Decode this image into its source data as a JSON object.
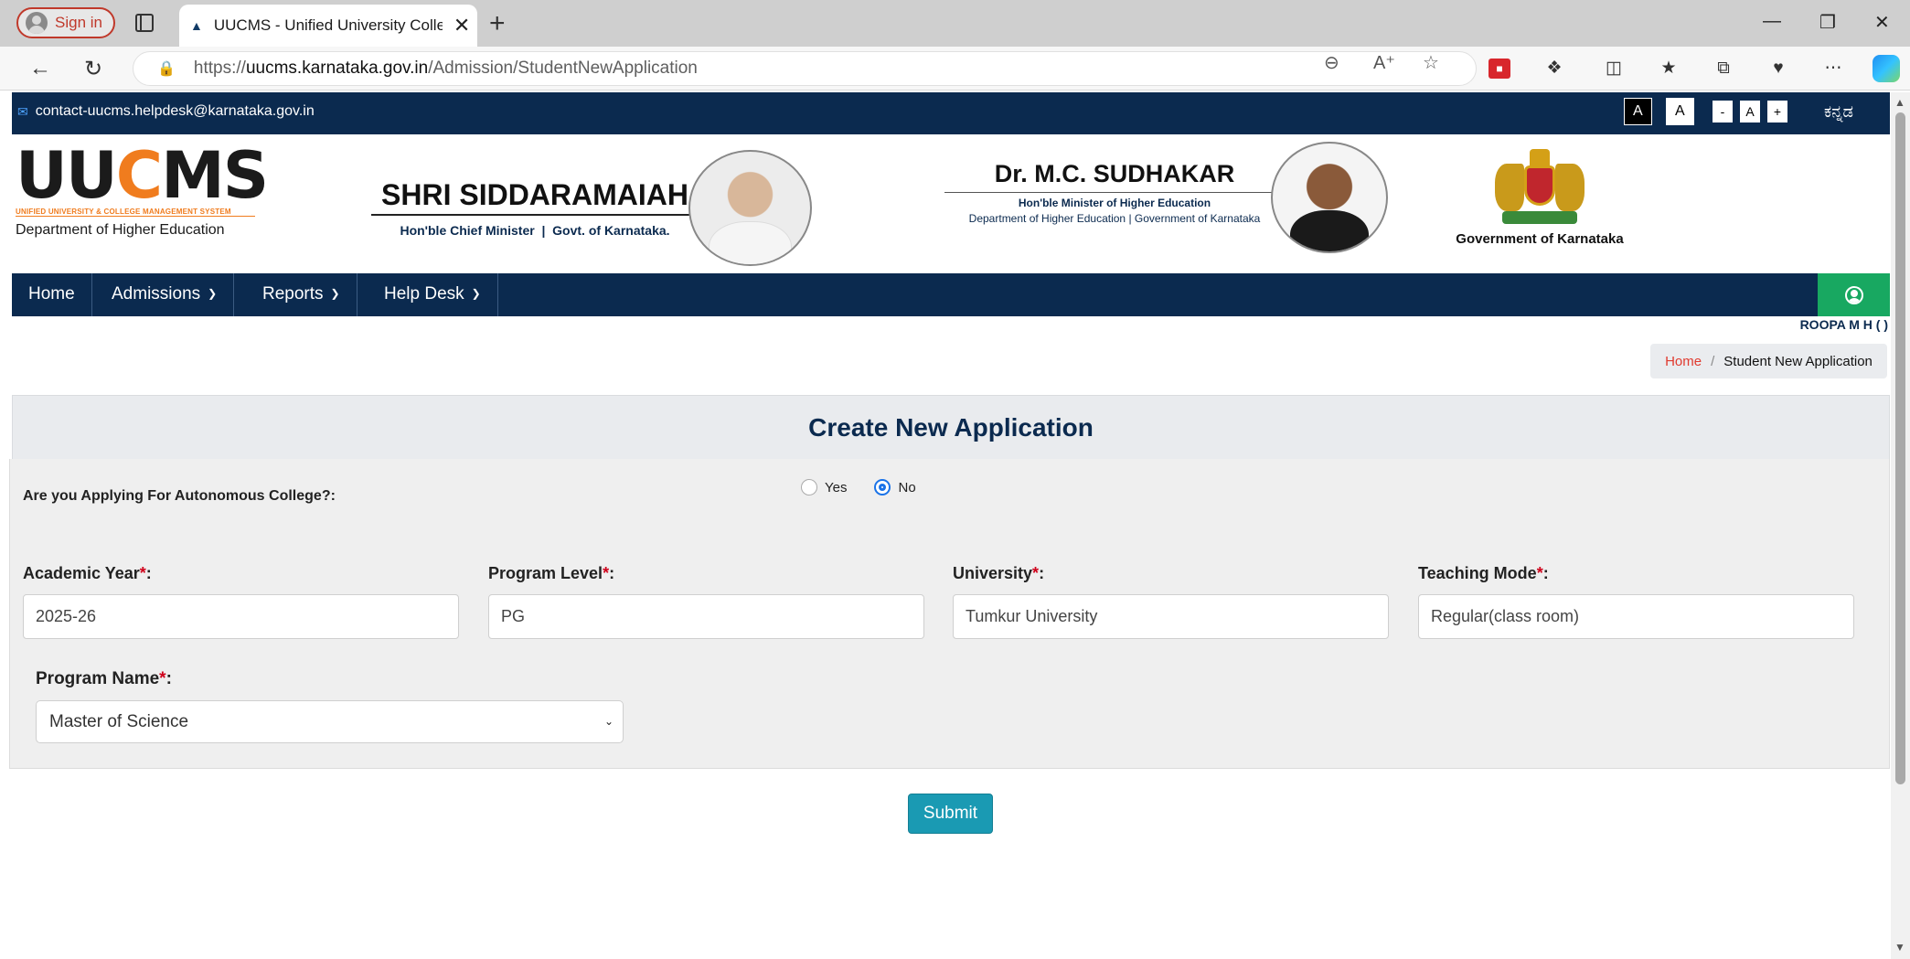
{
  "browser": {
    "signin_label": "Sign in",
    "tab_title": "UUCMS - Unified University College Management System",
    "url_prefix": "https://",
    "url_host": "uucms.karnataka.gov.in",
    "url_path": "/Admission/StudentNewApplication"
  },
  "site": {
    "email": "contact-uucms.helpdesk@karnataka.gov.in",
    "font_buttons": [
      "A",
      "A",
      "-",
      "A",
      "+"
    ],
    "language": "ಕನ್ನಡ",
    "logo_text_left": "UU",
    "logo_text_o": "C",
    "logo_text_right": "MS",
    "logo_tagline": "UNIFIED UNIVERSITY & COLLEGE MANAGEMENT SYSTEM",
    "logo_dept": "Department of Higher Education",
    "cm_name": "SHRI SIDDARAMAIAH",
    "cm_role": "Hon'ble Chief Minister",
    "cm_govt": "Govt. of Karnataka.",
    "minister_name": "Dr. M.C. SUDHAKAR",
    "minister_role": "Hon'ble Minister of Higher Education",
    "minister_dept": "Department of Higher Education",
    "minister_govt": "Government of Karnataka",
    "gok_label": "Government of Karnataka"
  },
  "nav": {
    "home": "Home",
    "admissions": "Admissions",
    "reports": "Reports",
    "helpdesk": "Help Desk",
    "user_name": "ROOPA M H ( )"
  },
  "breadcrumb": {
    "home": "Home",
    "sep": "/",
    "current": "Student New Application"
  },
  "form": {
    "heading": "Create New Application",
    "autonomous_question": "Are you Applying For Autonomous College?:",
    "radio_yes": "Yes",
    "radio_no": "No",
    "radio_selected": "No",
    "academic_year_label": "Academic Year",
    "academic_year_value": "2025-26",
    "program_level_label": "Program Level",
    "program_level_value": "PG",
    "university_label": "University",
    "university_value": "Tumkur University",
    "teaching_mode_label": "Teaching Mode",
    "teaching_mode_value": "Regular(class room)",
    "program_name_label": "Program Name",
    "program_name_value": "Master of Science",
    "required_mark": "*",
    "label_suffix": ":",
    "submit_label": "Submit"
  },
  "colors": {
    "navy": "#0b2a4f",
    "green": "#18a861",
    "submit": "#1a9ab3",
    "required": "#d0021b"
  }
}
